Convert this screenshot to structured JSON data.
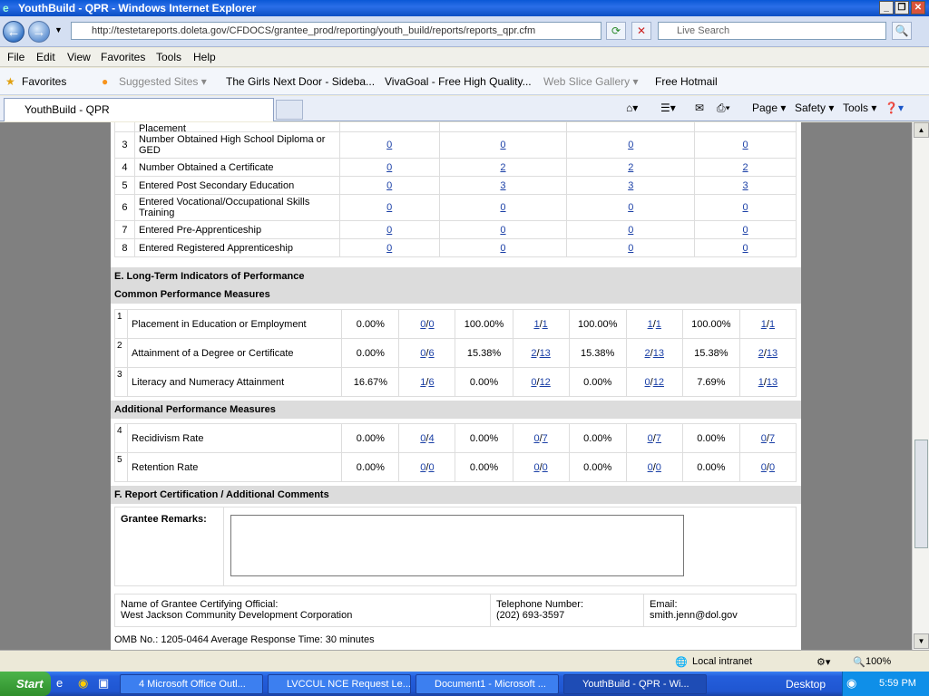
{
  "window": {
    "title": "YouthBuild - QPR - Windows Internet Explorer"
  },
  "nav": {
    "url": "http://testetareports.doleta.gov/CFDOCS/grantee_prod/reporting/youth_build/reports/reports_qpr.cfm",
    "search_placeholder": "Live Search"
  },
  "menu": [
    "File",
    "Edit",
    "View",
    "Favorites",
    "Tools",
    "Help"
  ],
  "favorites": {
    "label": "Favorites",
    "items": [
      "Suggested Sites ▾",
      "The Girls Next Door - Sideba...",
      "VivaGoal - Free High Quality...",
      "Web Slice Gallery ▾",
      "Free Hotmail"
    ]
  },
  "tab": {
    "label": "YouthBuild - QPR"
  },
  "commands": [
    "Page ▾",
    "Safety ▾",
    "Tools ▾"
  ],
  "partial_top": {
    "label": "Placement"
  },
  "outcomes": [
    {
      "n": "3",
      "label": "Number Obtained High School Diploma or GED",
      "v": [
        "0",
        "0",
        "0",
        "0"
      ]
    },
    {
      "n": "4",
      "label": "Number Obtained a Certificate",
      "v": [
        "0",
        "2",
        "2",
        "2"
      ]
    },
    {
      "n": "5",
      "label": "Entered Post Secondary Education",
      "v": [
        "0",
        "3",
        "3",
        "3"
      ]
    },
    {
      "n": "6",
      "label": "Entered Vocational/Occupational Skills Training",
      "v": [
        "0",
        "0",
        "0",
        "0"
      ]
    },
    {
      "n": "7",
      "label": "Entered Pre-Apprenticeship",
      "v": [
        "0",
        "0",
        "0",
        "0"
      ]
    },
    {
      "n": "8",
      "label": "Entered Registered Apprenticeship",
      "v": [
        "0",
        "0",
        "0",
        "0"
      ]
    }
  ],
  "section_e": {
    "title": "E. Long-Term Indicators of Performance",
    "common": "Common Performance Measures",
    "additional": "Additional Performance Measures"
  },
  "common_measures": [
    {
      "n": "1",
      "label": "Placement in Education or Employment",
      "cells": [
        [
          "0.00%",
          "0",
          "0"
        ],
        [
          "100.00%",
          "1",
          "1"
        ],
        [
          "100.00%",
          "1",
          "1"
        ],
        [
          "100.00%",
          "1",
          "1"
        ]
      ]
    },
    {
      "n": "2",
      "label": "Attainment of a Degree or Certificate",
      "cells": [
        [
          "0.00%",
          "0",
          "6"
        ],
        [
          "15.38%",
          "2",
          "13"
        ],
        [
          "15.38%",
          "2",
          "13"
        ],
        [
          "15.38%",
          "2",
          "13"
        ]
      ]
    },
    {
      "n": "3",
      "label": "Literacy and Numeracy Attainment",
      "cells": [
        [
          "16.67%",
          "1",
          "6"
        ],
        [
          "0.00%",
          "0",
          "12"
        ],
        [
          "0.00%",
          "0",
          "12"
        ],
        [
          "7.69%",
          "1",
          "13"
        ]
      ]
    }
  ],
  "additional_measures": [
    {
      "n": "4",
      "label": "Recidivism Rate",
      "cells": [
        [
          "0.00%",
          "0",
          "4"
        ],
        [
          "0.00%",
          "0",
          "7"
        ],
        [
          "0.00%",
          "0",
          "7"
        ],
        [
          "0.00%",
          "0",
          "7"
        ]
      ]
    },
    {
      "n": "5",
      "label": "Retention Rate",
      "cells": [
        [
          "0.00%",
          "0",
          "0"
        ],
        [
          "0.00%",
          "0",
          "0"
        ],
        [
          "0.00%",
          "0",
          "0"
        ],
        [
          "0.00%",
          "0",
          "0"
        ]
      ]
    }
  ],
  "section_f": {
    "title": "F. Report Certification / Additional Comments",
    "remarks_label": "Grantee Remarks:",
    "remarks_value": ""
  },
  "certification": {
    "official_label": "Name of Grantee Certifying Official:",
    "official_value": "West Jackson Community Development Corporation",
    "phone_label": "Telephone Number:",
    "phone_value": "(202) 693-3597",
    "email_label": "Email:",
    "email_value": "smith.jenn@dol.gov"
  },
  "omb": "OMB No.: 1205-0464 Average Response Time: 30 minutes",
  "status": {
    "zone": "Local intranet",
    "zoom": "100%"
  },
  "taskbar": {
    "start": "Start",
    "buttons": [
      "4 Microsoft Office Outl...",
      "LVCCUL NCE Request Le...",
      "Document1 - Microsoft ...",
      "YouthBuild - QPR - Wi..."
    ],
    "desktop": "Desktop",
    "time": "5:59 PM"
  }
}
